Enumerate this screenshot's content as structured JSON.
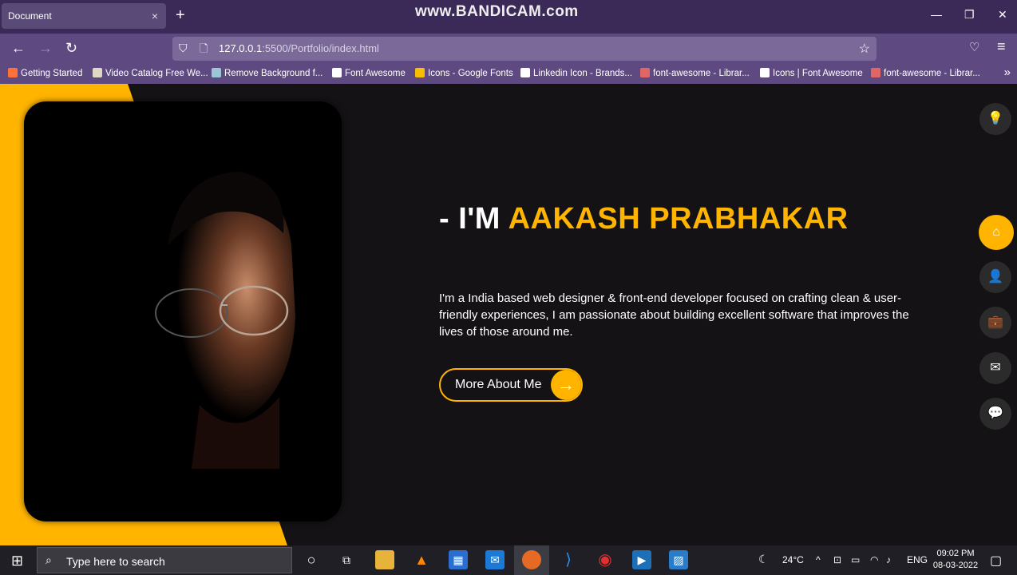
{
  "browser": {
    "tab_title": "Document",
    "tab_close": "×",
    "new_tab": "+",
    "watermark": "www.BANDICAM.com",
    "window_controls": {
      "minimize": "—",
      "restore": "❐",
      "close": "✕"
    },
    "url_host": "127.0.0.1",
    "url_rest": ":5500/Portfolio/index.html",
    "bookmarks": [
      {
        "label": "Getting Started",
        "icon_color": "#ff7139",
        "icon": "firefox-icon"
      },
      {
        "label": "Video Catalog Free We...",
        "icon_color": "#e0d7c6",
        "icon": "video-catalog-icon"
      },
      {
        "label": "Remove Background f...",
        "icon_color": "#9ac6d8",
        "icon": "remove-bg-icon"
      },
      {
        "label": "Font Awesome",
        "icon_color": "#ffffff",
        "icon": "flag-icon"
      },
      {
        "label": "Icons - Google Fonts",
        "icon_color": "#fbbc04",
        "icon": "google-fonts-icon"
      },
      {
        "label": "Linkedin Icon - Brands...",
        "icon_color": "#ffffff",
        "icon": "flag-icon"
      },
      {
        "label": "font-awesome - Librar...",
        "icon_color": "#e06666",
        "icon": "code-icon"
      },
      {
        "label": "Icons | Font Awesome",
        "icon_color": "#ffffff",
        "icon": "flag-icon"
      },
      {
        "label": "font-awesome - Librar...",
        "icon_color": "#e06666",
        "icon": "code-icon"
      }
    ],
    "bookmarks_more": "»"
  },
  "hero": {
    "prefix": "- I'M ",
    "name": "AAKASH PRABHAKAR",
    "bio": "I'm a India based web designer & front-end developer focused on crafting clean & user-friendly experiences, I am passionate about building excellent software that improves the lives of those around me.",
    "cta_label": "More About Me",
    "cta_arrow": "→"
  },
  "side_nav": [
    {
      "name": "theme-toggle",
      "icon": "lightbulb-icon",
      "glyph": "💡",
      "active": false
    },
    {
      "name": "nav-home",
      "icon": "home-icon",
      "glyph": "⌂",
      "active": true
    },
    {
      "name": "nav-about",
      "icon": "user-icon",
      "glyph": "👤",
      "active": false
    },
    {
      "name": "nav-portfolio",
      "icon": "briefcase-icon",
      "glyph": "💼",
      "active": false
    },
    {
      "name": "nav-contact",
      "icon": "envelope-icon",
      "glyph": "✉",
      "active": false
    },
    {
      "name": "nav-blog",
      "icon": "comments-icon",
      "glyph": "💬",
      "active": false
    }
  ],
  "taskbar": {
    "search_placeholder": "Type here to search",
    "weather": "24°C",
    "language": "ENG",
    "time": "09:02 PM",
    "date": "08-03-2022"
  },
  "colors": {
    "accent": "#ffb400",
    "background": "#141214",
    "chrome": "#5e4a80"
  }
}
